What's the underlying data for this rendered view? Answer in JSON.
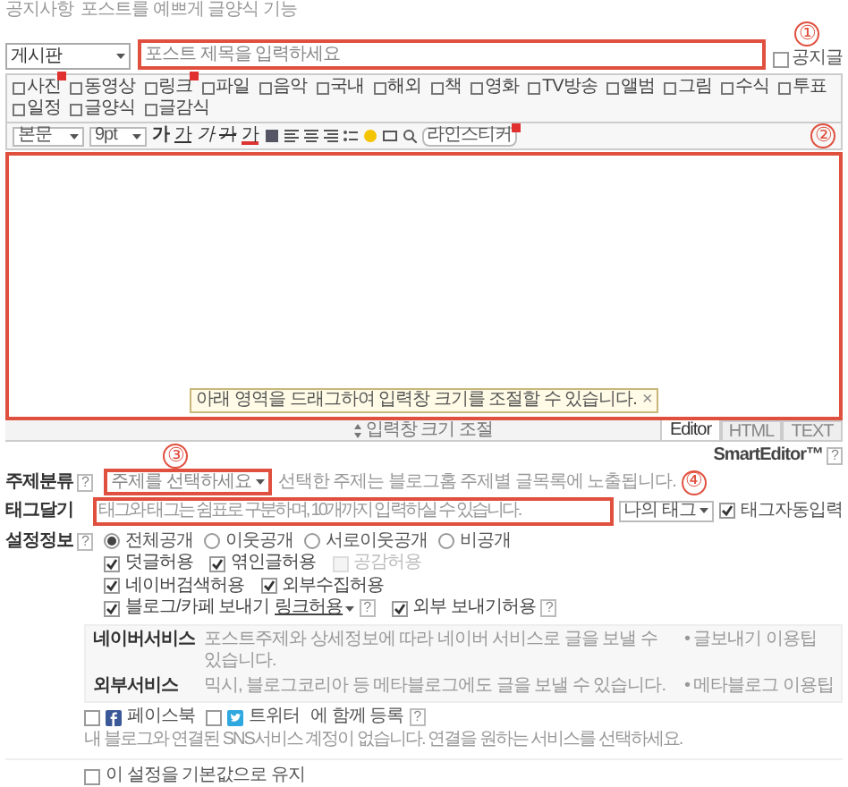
{
  "notice": {
    "label": "공지사항",
    "text": "포스트를 예쁘게 글양식 기능"
  },
  "title_row": {
    "category": "게시판",
    "placeholder": "포스트 제목을 입력하세요",
    "marker": "①",
    "notice_post": {
      "label": "공지글",
      "checked": false
    }
  },
  "toolbar_insert": [
    {
      "label": "사진",
      "new": true
    },
    {
      "label": "동영상",
      "new": false
    },
    {
      "label": "링크",
      "new": true
    },
    {
      "label": "파일",
      "new": false
    },
    {
      "label": "음악",
      "new": false
    },
    {
      "label": "국내",
      "new": false
    },
    {
      "label": "해외",
      "new": false
    },
    {
      "label": "책",
      "new": false
    },
    {
      "label": "영화",
      "new": false
    },
    {
      "label": "TV방송",
      "new": false
    },
    {
      "label": "앨범",
      "new": false
    },
    {
      "label": "그림",
      "new": false
    },
    {
      "label": "수식",
      "new": false
    },
    {
      "label": "투표",
      "new": false
    },
    {
      "label": "일정",
      "new": false
    },
    {
      "label": "글양식",
      "new": false
    },
    {
      "label": "글감식",
      "new": false
    }
  ],
  "toolbar_format": {
    "style": "본문",
    "size": "9pt",
    "glyphs": [
      {
        "label": "가",
        "kind": "bold"
      },
      {
        "label": "가",
        "kind": "underline"
      },
      {
        "label": "가",
        "kind": "italic"
      },
      {
        "label": "가",
        "kind": "strike"
      },
      {
        "label": "가",
        "kind": "color"
      }
    ],
    "sticker": {
      "label": "라인스티커",
      "new": true
    },
    "marker": "②"
  },
  "editor": {
    "tip": "아래 영역을 드래그하여 입력창 크기를 조절할 수 있습니다.",
    "close": "×",
    "resize": "입력창 크기 조절",
    "modes": [
      {
        "label": "Editor",
        "selected": true
      },
      {
        "label": "HTML",
        "selected": false
      },
      {
        "label": "TEXT",
        "selected": false
      }
    ]
  },
  "brand": {
    "text": "SmartEditor™",
    "help": "?"
  },
  "topic": {
    "label": "주제분류",
    "help": "?",
    "value": "주제를 선택하세요",
    "marker": "③",
    "hint": "선택한 주제는 블로그홈 주제별 글목록에 노출됩니다."
  },
  "tags": {
    "label": "태그달기",
    "placeholder": "태그와 태그는 쉼표로 구분하며, 10개까지 입력하실 수 있습니다.",
    "marker": "④",
    "my_tags": "나의 태그",
    "auto": {
      "label": "태그자동입력",
      "checked": true
    }
  },
  "settings": {
    "label": "설정정보",
    "help": "?",
    "visibility": [
      {
        "label": "전체공개",
        "selected": true
      },
      {
        "label": "이웃공개",
        "selected": false
      },
      {
        "label": "서로이웃공개",
        "selected": false
      },
      {
        "label": "비공개",
        "selected": false
      }
    ],
    "option_rows": [
      [
        {
          "label": "덧글허용",
          "checked": true,
          "disabled": false
        },
        {
          "label": "엮인글허용",
          "checked": true,
          "disabled": false
        },
        {
          "label": "공감허용",
          "checked": false,
          "disabled": true
        }
      ],
      [
        {
          "label": "네이버검색허용",
          "checked": true,
          "disabled": false
        },
        {
          "label": "외부수집허용",
          "checked": true,
          "disabled": false
        }
      ],
      [
        {
          "label": "블로그/카페 보내기",
          "link": "링크허용",
          "help": "?",
          "checked": true,
          "disabled": false
        },
        {
          "label": "외부 보내기허용",
          "help": "?",
          "checked": true,
          "disabled": false
        }
      ]
    ]
  },
  "services": [
    {
      "name": "네이버서비스",
      "text": "포스트주제와 상세정보에 따라 네이버 서비스로 글을 보낼 수 있습니다.",
      "tip": "• 글보내기 이용팁"
    },
    {
      "name": "외부서비스",
      "text": "믹시, 블로그코리아 등 메타블로그에도 글을 보낼 수 있습니다.",
      "tip": "• 메타블로그 이용팁"
    }
  ],
  "sns": {
    "services": [
      {
        "label": "페이스북",
        "checked": false,
        "kind": "facebook"
      },
      {
        "label": "트위터",
        "checked": false,
        "kind": "twitter"
      }
    ],
    "suffix": "에 함께 등록",
    "help": "?",
    "note": "내 블로그와 연결된 SNS서비스 계정이 없습니다. 연결을 원하는 서비스를 선택하세요."
  },
  "keep_default": {
    "label": "이 설정을 기본값으로 유지",
    "checked": false
  }
}
